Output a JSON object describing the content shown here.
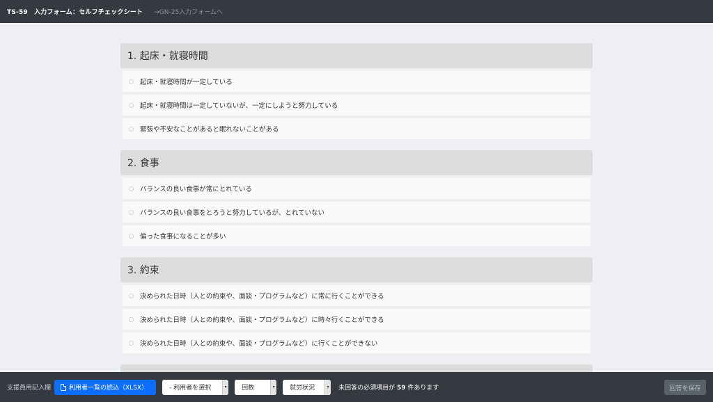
{
  "header": {
    "title": "TS-59　入力フォーム：セルフチェックシート",
    "link": "→GN-25入力フォームへ"
  },
  "sections": [
    {
      "title": "1. 起床・就寝時間",
      "options": [
        "起床・就寝時間が一定している",
        "起床・就寝時間は一定していないが、一定にしようと努力している",
        "緊張や不安なことがあると眠れないことがある"
      ]
    },
    {
      "title": "2. 食事",
      "options": [
        "バランスの良い食事が常にとれている",
        "バランスの良い食事をとろうと努力しているが、とれていない",
        "偏った食事になることが多い"
      ]
    },
    {
      "title": "3. 約束",
      "options": [
        "決められた日時（人との約束や、面談・プログラムなど）に常に行くことができる",
        "決められた日時（人との約束や、面談・プログラムなど）に時々行くことができる",
        "決められた日時（人との約束や、面談・プログラムなど）に行くことができない"
      ]
    }
  ],
  "footer": {
    "label": "支援員用記入欄",
    "import_button": "利用者一覧の読込（XLSX）",
    "user_select": "- 利用者を選択",
    "count_select": "回数",
    "status_select": "就労状況",
    "unanswered_prefix": "未回答の必須項目が",
    "unanswered_count": "59",
    "unanswered_suffix": "件あります",
    "save_button": "回答を保存"
  },
  "colors": {
    "topbar": "#343a40",
    "primary": "#0d6efd",
    "section_header": "#dcdcdc",
    "background": "#eeeff2"
  }
}
